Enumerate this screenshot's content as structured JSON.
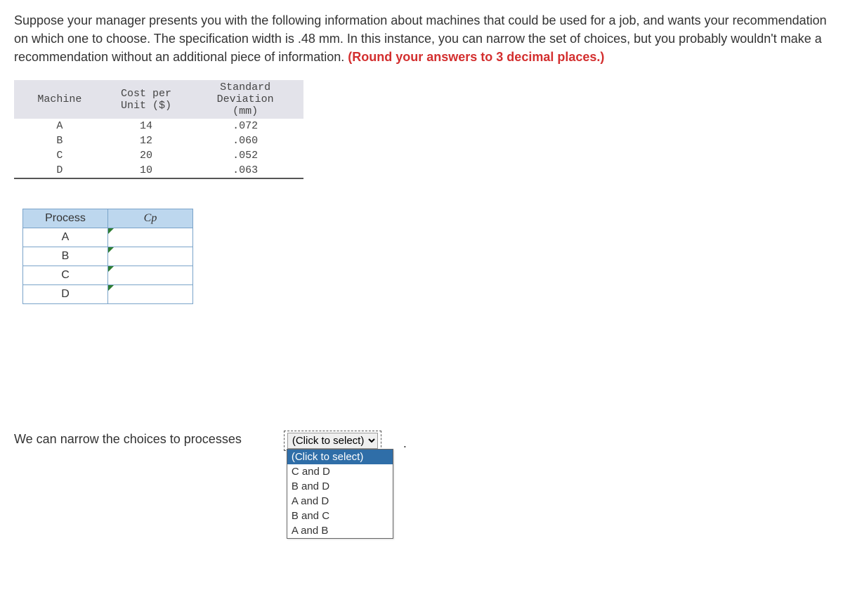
{
  "prompt": {
    "part1": "Suppose your manager presents you with the following information about machines that could be used for a job, and wants your recommendation on which one to choose. The specification width is .48 mm. In this instance, you can narrow the set of choices, but you probably wouldn't make a recommendation without an additional piece of information. ",
    "bold": "(Round your answers to 3 decimal places.)"
  },
  "data_table": {
    "headers": {
      "machine": "Machine",
      "cost_line1": "Cost per",
      "cost_line2": "Unit ($)",
      "sd_line1": "Standard Deviation",
      "sd_line2": "(mm)"
    },
    "rows": [
      {
        "machine": "A",
        "cost": "14",
        "sd": ".072"
      },
      {
        "machine": "B",
        "cost": "12",
        "sd": ".060"
      },
      {
        "machine": "C",
        "cost": "20",
        "sd": ".052"
      },
      {
        "machine": "D",
        "cost": "10",
        "sd": ".063"
      }
    ]
  },
  "ans_table": {
    "headers": {
      "process": "Process",
      "cp": "Cp"
    },
    "rows": [
      "A",
      "B",
      "C",
      "D"
    ]
  },
  "bottom": {
    "text": "We can narrow the choices to processes",
    "placeholder": "(Click to select)",
    "options": [
      "(Click to select)",
      "C and D",
      "B and D",
      "A and D",
      "B and C",
      "A and B"
    ],
    "period": "."
  }
}
